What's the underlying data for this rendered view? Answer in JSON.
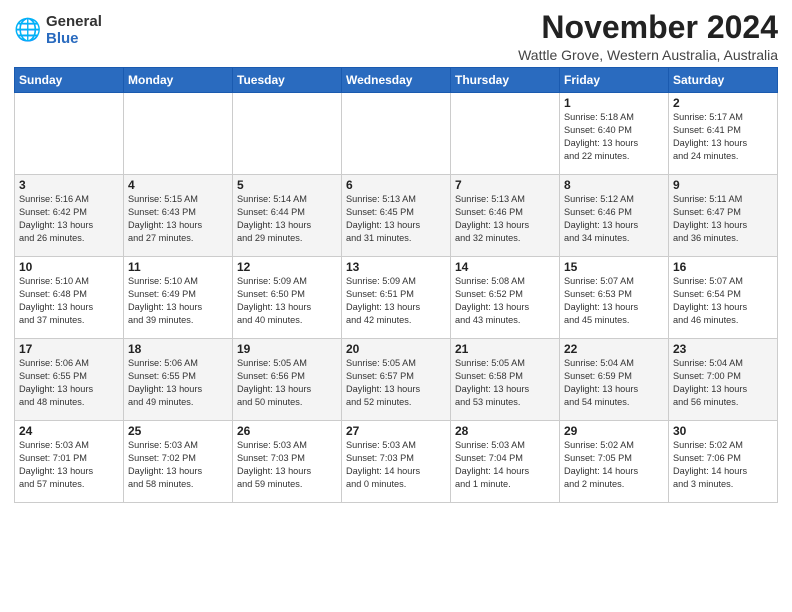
{
  "logo": {
    "general": "General",
    "blue": "Blue"
  },
  "title": "November 2024",
  "location": "Wattle Grove, Western Australia, Australia",
  "weekdays": [
    "Sunday",
    "Monday",
    "Tuesday",
    "Wednesday",
    "Thursday",
    "Friday",
    "Saturday"
  ],
  "weeks": [
    [
      {
        "day": "",
        "info": ""
      },
      {
        "day": "",
        "info": ""
      },
      {
        "day": "",
        "info": ""
      },
      {
        "day": "",
        "info": ""
      },
      {
        "day": "",
        "info": ""
      },
      {
        "day": "1",
        "info": "Sunrise: 5:18 AM\nSunset: 6:40 PM\nDaylight: 13 hours\nand 22 minutes."
      },
      {
        "day": "2",
        "info": "Sunrise: 5:17 AM\nSunset: 6:41 PM\nDaylight: 13 hours\nand 24 minutes."
      }
    ],
    [
      {
        "day": "3",
        "info": "Sunrise: 5:16 AM\nSunset: 6:42 PM\nDaylight: 13 hours\nand 26 minutes."
      },
      {
        "day": "4",
        "info": "Sunrise: 5:15 AM\nSunset: 6:43 PM\nDaylight: 13 hours\nand 27 minutes."
      },
      {
        "day": "5",
        "info": "Sunrise: 5:14 AM\nSunset: 6:44 PM\nDaylight: 13 hours\nand 29 minutes."
      },
      {
        "day": "6",
        "info": "Sunrise: 5:13 AM\nSunset: 6:45 PM\nDaylight: 13 hours\nand 31 minutes."
      },
      {
        "day": "7",
        "info": "Sunrise: 5:13 AM\nSunset: 6:46 PM\nDaylight: 13 hours\nand 32 minutes."
      },
      {
        "day": "8",
        "info": "Sunrise: 5:12 AM\nSunset: 6:46 PM\nDaylight: 13 hours\nand 34 minutes."
      },
      {
        "day": "9",
        "info": "Sunrise: 5:11 AM\nSunset: 6:47 PM\nDaylight: 13 hours\nand 36 minutes."
      }
    ],
    [
      {
        "day": "10",
        "info": "Sunrise: 5:10 AM\nSunset: 6:48 PM\nDaylight: 13 hours\nand 37 minutes."
      },
      {
        "day": "11",
        "info": "Sunrise: 5:10 AM\nSunset: 6:49 PM\nDaylight: 13 hours\nand 39 minutes."
      },
      {
        "day": "12",
        "info": "Sunrise: 5:09 AM\nSunset: 6:50 PM\nDaylight: 13 hours\nand 40 minutes."
      },
      {
        "day": "13",
        "info": "Sunrise: 5:09 AM\nSunset: 6:51 PM\nDaylight: 13 hours\nand 42 minutes."
      },
      {
        "day": "14",
        "info": "Sunrise: 5:08 AM\nSunset: 6:52 PM\nDaylight: 13 hours\nand 43 minutes."
      },
      {
        "day": "15",
        "info": "Sunrise: 5:07 AM\nSunset: 6:53 PM\nDaylight: 13 hours\nand 45 minutes."
      },
      {
        "day": "16",
        "info": "Sunrise: 5:07 AM\nSunset: 6:54 PM\nDaylight: 13 hours\nand 46 minutes."
      }
    ],
    [
      {
        "day": "17",
        "info": "Sunrise: 5:06 AM\nSunset: 6:55 PM\nDaylight: 13 hours\nand 48 minutes."
      },
      {
        "day": "18",
        "info": "Sunrise: 5:06 AM\nSunset: 6:55 PM\nDaylight: 13 hours\nand 49 minutes."
      },
      {
        "day": "19",
        "info": "Sunrise: 5:05 AM\nSunset: 6:56 PM\nDaylight: 13 hours\nand 50 minutes."
      },
      {
        "day": "20",
        "info": "Sunrise: 5:05 AM\nSunset: 6:57 PM\nDaylight: 13 hours\nand 52 minutes."
      },
      {
        "day": "21",
        "info": "Sunrise: 5:05 AM\nSunset: 6:58 PM\nDaylight: 13 hours\nand 53 minutes."
      },
      {
        "day": "22",
        "info": "Sunrise: 5:04 AM\nSunset: 6:59 PM\nDaylight: 13 hours\nand 54 minutes."
      },
      {
        "day": "23",
        "info": "Sunrise: 5:04 AM\nSunset: 7:00 PM\nDaylight: 13 hours\nand 56 minutes."
      }
    ],
    [
      {
        "day": "24",
        "info": "Sunrise: 5:03 AM\nSunset: 7:01 PM\nDaylight: 13 hours\nand 57 minutes."
      },
      {
        "day": "25",
        "info": "Sunrise: 5:03 AM\nSunset: 7:02 PM\nDaylight: 13 hours\nand 58 minutes."
      },
      {
        "day": "26",
        "info": "Sunrise: 5:03 AM\nSunset: 7:03 PM\nDaylight: 13 hours\nand 59 minutes."
      },
      {
        "day": "27",
        "info": "Sunrise: 5:03 AM\nSunset: 7:03 PM\nDaylight: 14 hours\nand 0 minutes."
      },
      {
        "day": "28",
        "info": "Sunrise: 5:03 AM\nSunset: 7:04 PM\nDaylight: 14 hours\nand 1 minute."
      },
      {
        "day": "29",
        "info": "Sunrise: 5:02 AM\nSunset: 7:05 PM\nDaylight: 14 hours\nand 2 minutes."
      },
      {
        "day": "30",
        "info": "Sunrise: 5:02 AM\nSunset: 7:06 PM\nDaylight: 14 hours\nand 3 minutes."
      }
    ]
  ]
}
